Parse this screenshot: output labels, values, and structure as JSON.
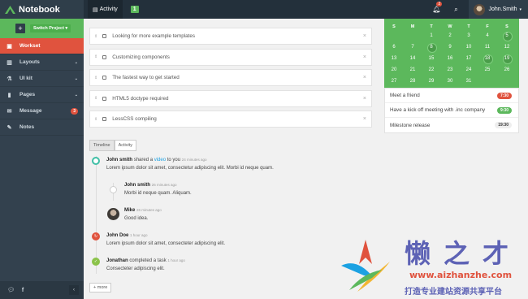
{
  "header": {
    "brand": "Notebook",
    "nav_activity": "Activity",
    "nav_badge": "1",
    "bell_count": "2",
    "user_name": "John.Smith"
  },
  "sidebar": {
    "switch_project": "Switch Project",
    "items": [
      {
        "label": "Workset",
        "icon": "briefcase-icon",
        "active": true
      },
      {
        "label": "Layouts",
        "icon": "columns-icon",
        "chevron": true
      },
      {
        "label": "UI kit",
        "icon": "flask-icon",
        "chevron": true
      },
      {
        "label": "Pages",
        "icon": "file-icon",
        "chevron": true
      },
      {
        "label": "Message",
        "icon": "envelope-icon",
        "count": "3"
      },
      {
        "label": "Notes",
        "icon": "pencil-icon"
      }
    ]
  },
  "tasks": [
    "Looking for more example templates",
    "Customizing components",
    "The fastest way to get started",
    "HTML5 doctype required",
    "LessCSS compiling"
  ],
  "timeline": {
    "tabs": [
      "Timeline",
      "Activity"
    ],
    "entries": [
      {
        "name": "John smith",
        "action": "shared a",
        "link": "video",
        "tail": "to you",
        "time": "24 minutes ago",
        "body": "Lorem ipsum dolor sit amet, consectetur adipiscing elit. Morbi id neque quam."
      },
      {
        "name": "John smith",
        "time": "26 minutes ago",
        "body": "Morbi id neque quam. Aliquam."
      },
      {
        "name": "Mike",
        "time": "26 minutes ago",
        "body": "Good idea."
      },
      {
        "name": "John Doe",
        "time": "1 hour ago",
        "body": "Lorem ipsum dolor sit amet, consecteter adipiscing elit."
      },
      {
        "name": "Jonathan",
        "action": "completed a task",
        "time": "1 hour ago",
        "body": "Consecteter adipiscing elit."
      }
    ],
    "more": "more"
  },
  "calendar": {
    "day_headers": [
      "S",
      "M",
      "T",
      "W",
      "T",
      "F",
      "S"
    ],
    "rows": [
      [
        "",
        "",
        "1",
        "2",
        "3",
        "4",
        "5"
      ],
      [
        "6",
        "7",
        "8",
        "9",
        "10",
        "11",
        "12"
      ],
      [
        "13",
        "14",
        "15",
        "16",
        "17",
        "18",
        "19"
      ],
      [
        "20",
        "21",
        "22",
        "23",
        "24",
        "25",
        "26"
      ],
      [
        "27",
        "28",
        "29",
        "30",
        "31",
        "",
        ""
      ]
    ]
  },
  "events": [
    {
      "title": "Meet a friend",
      "time": "7:30",
      "color": "red"
    },
    {
      "title": "Have a kick off meeting with .inc company",
      "time": "9:30",
      "color": "green"
    },
    {
      "title": "Milestone release",
      "time": "19:30",
      "color": "light"
    }
  ],
  "watermark": {
    "chars": "懒之才",
    "url": "www.aizhanzhe.com",
    "tagline": "打造专业建站资源共享平台"
  },
  "colors": {
    "accent_green": "#5cb85c",
    "accent_red": "#e0533e",
    "sidebar_bg": "#33414e",
    "header_bg": "#23303b"
  }
}
